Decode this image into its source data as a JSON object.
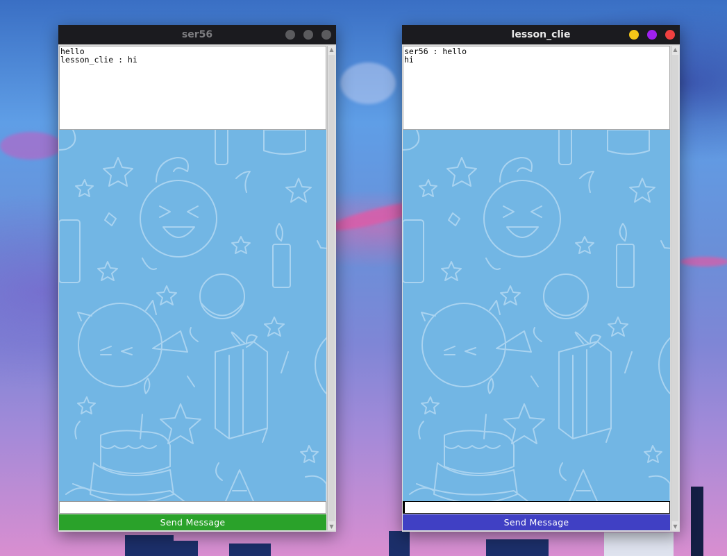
{
  "windows": [
    {
      "title": "ser56",
      "chat_log": "hello\nlesson_clie : hi",
      "input_value": "",
      "send_label": "Send Message",
      "send_color": "#2aa22a",
      "title_color": "#7d7d80",
      "controls": [
        {
          "name": "minimize-button",
          "color": "#5b5b5e"
        },
        {
          "name": "maximize-button",
          "color": "#5b5b5e"
        },
        {
          "name": "close-button",
          "color": "#5b5b5e"
        }
      ]
    },
    {
      "title": "lesson_clie",
      "chat_log": "ser56 : hello\nhi",
      "input_value": "",
      "send_label": "Send Message",
      "send_color": "#4040c4",
      "title_color": "#e9e9e9",
      "controls": [
        {
          "name": "minimize-button",
          "color": "#f5c518"
        },
        {
          "name": "maximize-button",
          "color": "#a020f0"
        },
        {
          "name": "close-button",
          "color": "#f04040"
        }
      ]
    }
  ],
  "colors": {
    "wallpaper_bg": "#72b6e4",
    "doodle_stroke": "#a9d3f0"
  }
}
